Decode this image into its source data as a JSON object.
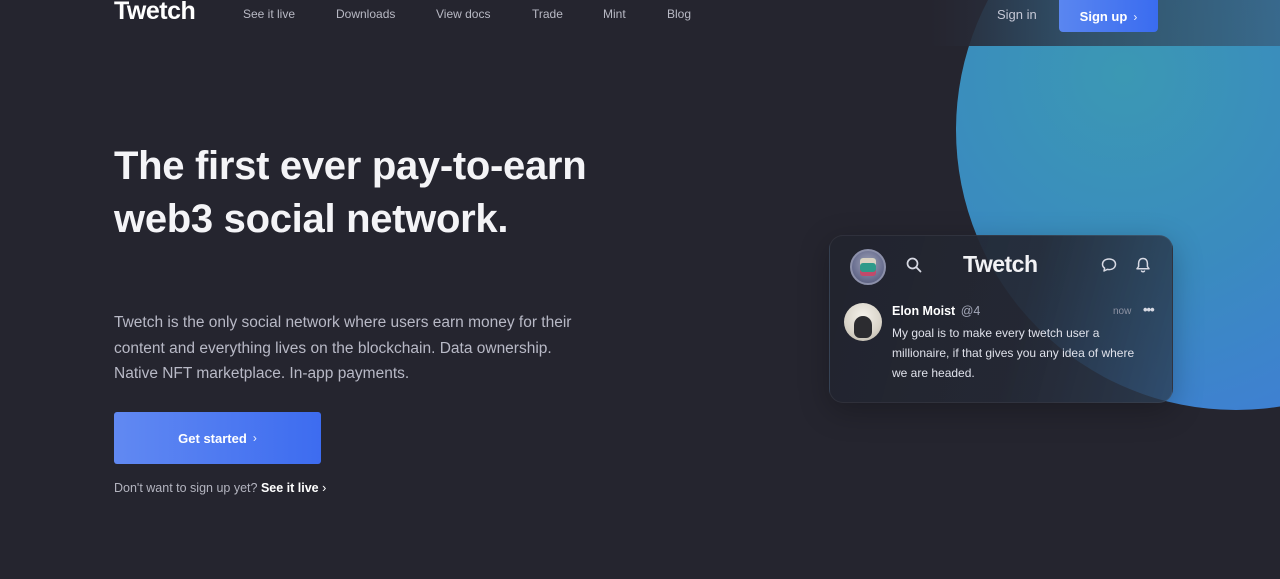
{
  "brand": {
    "name": "Twetch",
    "accent_color": "#4f7df1",
    "orb_color": "#3b8cc7"
  },
  "nav": {
    "links": [
      {
        "label": "See it live"
      },
      {
        "label": "Downloads"
      },
      {
        "label": "View docs"
      },
      {
        "label": "Trade"
      },
      {
        "label": "Mint"
      },
      {
        "label": "Blog"
      }
    ],
    "signin_label": "Sign in",
    "signup_label": "Sign up",
    "signup_icon": "chevron-right-icon"
  },
  "hero": {
    "title": "The first ever pay-to-earn web3 social network.",
    "description": "Twetch is the only social network where users earn money for their content and everything lives on the blockchain. Data ownership. Native NFT marketplace. In-app payments.",
    "cta_label": "Get started",
    "cta_icon": "chevron-right-icon",
    "subcta_prefix": "Don't want to sign up yet?",
    "subcta_link": "See it live"
  },
  "app_preview": {
    "logo": "Twetch",
    "icons": [
      "profile-avatar",
      "search-icon",
      "chat-bubble-icon",
      "bell-icon"
    ],
    "post": {
      "author": "Elon Moist",
      "handle": "@4",
      "time": "now",
      "more_icon": "ellipsis-icon",
      "text": "My goal is to make every twetch user a millionaire, if that gives you any idea of where we are headed."
    }
  }
}
